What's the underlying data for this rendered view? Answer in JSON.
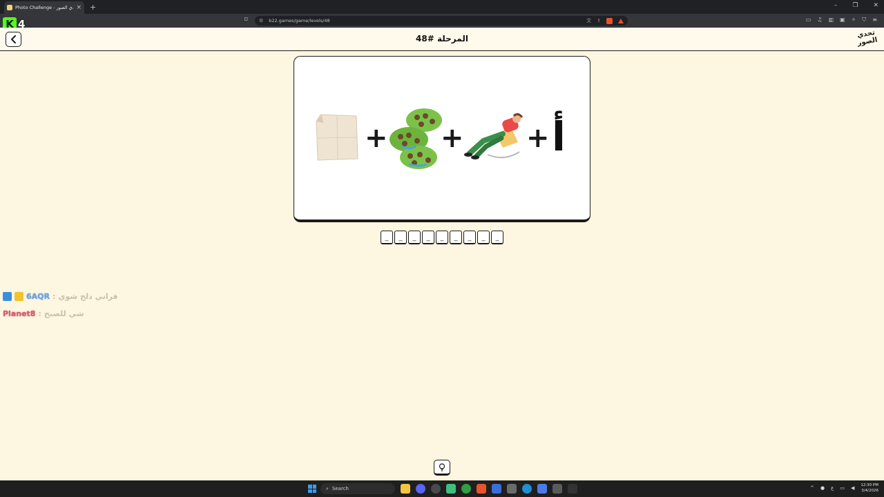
{
  "browser": {
    "tab_title": "Photo Challenge - تحدي الصور",
    "tab_close": "×",
    "new_tab": "+",
    "url": "b22.games/game/levels/48",
    "window_controls": [
      "–",
      "❐",
      "✕"
    ]
  },
  "stream": {
    "logo_letter": "K",
    "viewer_count": "4"
  },
  "header": {
    "back_icon": "chevron-left-icon",
    "level_title": "المرحلة #48",
    "logo_text": "تحدي الصور"
  },
  "puzzle": {
    "plus_signs": [
      "+",
      "+",
      "+"
    ],
    "letter": "أ",
    "images": [
      "paper-sheet-image",
      "green-fields-image",
      "man-relaxing-on-rocking-chair-image"
    ]
  },
  "answer": {
    "slots": [
      "_",
      "_",
      "_",
      "_",
      "_",
      "_",
      "_",
      "_",
      "_"
    ]
  },
  "chat": [
    {
      "user": "6AQR",
      "separator": ":",
      "message": "قراني دلخ شوي"
    },
    {
      "user": "Planet8",
      "separator": ":",
      "message": "شي للصبح"
    }
  ],
  "hint": {
    "icon": "lightbulb-icon"
  },
  "taskbar": {
    "search_label": "Search",
    "time": "12:30 PM",
    "date": "3/4/2026"
  },
  "colors": {
    "page_bg": "#fdf6e0",
    "card_bg": "#ffffff",
    "border": "#1a1a1a",
    "chat_user_1": "#6aa8e6",
    "chat_user_2": "#e25a6e"
  }
}
